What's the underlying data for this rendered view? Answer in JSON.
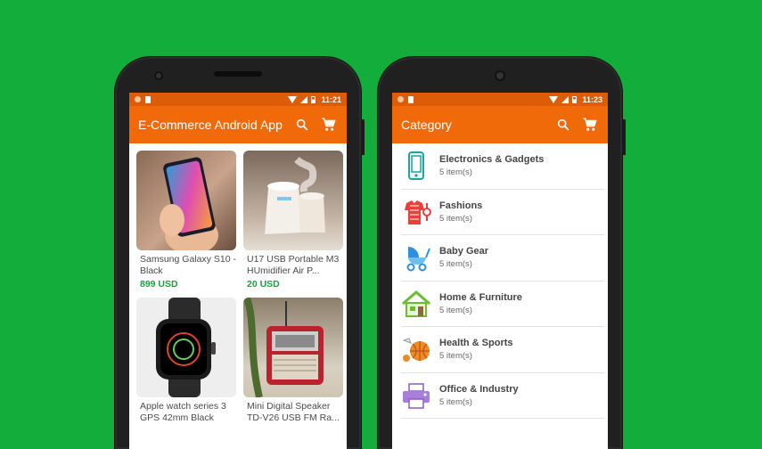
{
  "colors": {
    "background": "#13ad3c",
    "accent": "#f06a0a",
    "statusbar": "#dd5c07",
    "price": "#1e9e3e"
  },
  "left_phone": {
    "status": {
      "time": "11:21"
    },
    "appbar": {
      "title": "E-Commerce Android App",
      "search_icon": "search-icon",
      "cart_icon": "cart-icon"
    },
    "products": [
      {
        "name": "Samsung Galaxy S10 - Black",
        "price": "899 USD"
      },
      {
        "name": "U17 USB Portable M3 HUmidifier Air P...",
        "price": "20 USD"
      },
      {
        "name": "Apple watch series 3 GPS 42mm Black",
        "price": ""
      },
      {
        "name": "Mini Digital Speaker TD-V26 USB FM Ra...",
        "price": ""
      }
    ]
  },
  "right_phone": {
    "status": {
      "time": "11:23"
    },
    "appbar": {
      "title": "Category",
      "search_icon": "search-icon",
      "cart_icon": "cart-icon"
    },
    "categories": [
      {
        "name": "Electronics & Gadgets",
        "count": "5 item(s)",
        "icon": "phone-icon"
      },
      {
        "name": "Fashions",
        "count": "5 item(s)",
        "icon": "shirt-icon"
      },
      {
        "name": "Baby Gear",
        "count": "5 item(s)",
        "icon": "stroller-icon"
      },
      {
        "name": "Home & Furniture",
        "count": "5 item(s)",
        "icon": "house-icon"
      },
      {
        "name": "Health & Sports",
        "count": "5 item(s)",
        "icon": "ball-icon"
      },
      {
        "name": "Office & Industry",
        "count": "5 item(s)",
        "icon": "printer-icon"
      }
    ]
  }
}
